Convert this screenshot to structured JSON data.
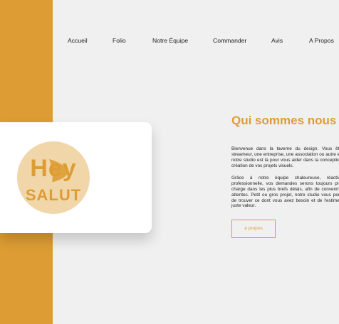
{
  "nav": {
    "items": [
      {
        "label": "Accueil"
      },
      {
        "label": "Folio"
      },
      {
        "label": "Notre Équipe"
      },
      {
        "label": "Commander"
      },
      {
        "label": "Avis"
      },
      {
        "label": "A Propos"
      }
    ]
  },
  "logo": {
    "text_top": "Hey",
    "text_bottom": "SALUT",
    "circle_color": "#f0d6a9",
    "ink_color": "#dd9d34"
  },
  "about": {
    "title": "Qui sommes nous",
    "paragraph1": "Bienvenue dans la taverne du design. Vous êtes un streameur, une entreprise, une association ou autre encore, notre studio est là pour vous aider dans la conception et la création de vos projets visuels.",
    "paragraph2": "Grâce à notre équipe chaleureuse, réactive et professionnelle, vos demandes serons toujours prise en charge dans les plus brefs délais, afin de convenir à vos attentes. Petit ou gros projet, notre studio vous permettra de trouver ce dont vous avez besoin et de l'estimer à sa juste valeur.",
    "button_label": "a propos"
  },
  "colors": {
    "accent": "#dd9d34",
    "background": "#f0f0f0",
    "text": "#222222"
  }
}
